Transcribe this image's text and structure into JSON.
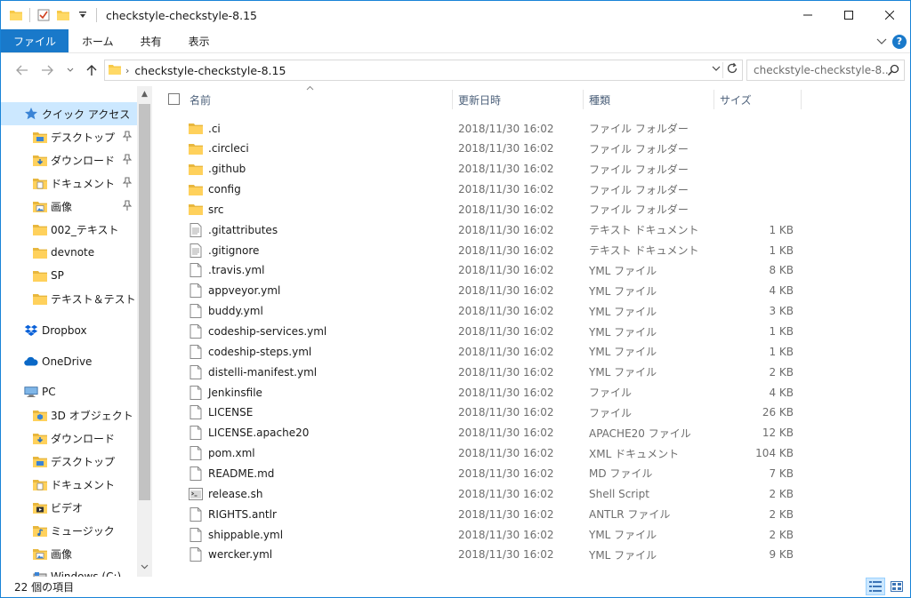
{
  "window": {
    "title": "checkstyle-checkstyle-8.15",
    "accent": "#1979ca"
  },
  "ribbon": {
    "tabs": [
      "ファイル",
      "ホーム",
      "共有",
      "表示"
    ]
  },
  "nav": {
    "address_path": "checkstyle-checkstyle-8.15",
    "search_placeholder": "checkstyle-checkstyle-8..."
  },
  "sidebar": {
    "items": [
      {
        "label": "クイック アクセス",
        "icon": "star-icon",
        "pinned": false,
        "selected": true
      },
      {
        "label": "デスクトップ",
        "icon": "desktop-folder-icon",
        "pinned": true
      },
      {
        "label": "ダウンロード",
        "icon": "download-folder-icon",
        "pinned": true
      },
      {
        "label": "ドキュメント",
        "icon": "documents-folder-icon",
        "pinned": true
      },
      {
        "label": "画像",
        "icon": "pictures-folder-icon",
        "pinned": true
      },
      {
        "label": "002_テキスト",
        "icon": "folder-icon",
        "pinned": false
      },
      {
        "label": "devnote",
        "icon": "folder-icon",
        "pinned": false
      },
      {
        "label": "SP",
        "icon": "folder-icon",
        "pinned": false
      },
      {
        "label": "テキスト＆テスト",
        "icon": "folder-icon",
        "pinned": false
      },
      {
        "label": "Dropbox",
        "icon": "dropbox-icon",
        "pinned": false
      },
      {
        "label": "OneDrive",
        "icon": "onedrive-icon",
        "pinned": false
      },
      {
        "label": "PC",
        "icon": "pc-icon",
        "pinned": false
      },
      {
        "label": "3D オブジェクト",
        "icon": "3d-objects-icon",
        "pinned": false
      },
      {
        "label": "ダウンロード",
        "icon": "download-folder-icon",
        "pinned": false
      },
      {
        "label": "デスクトップ",
        "icon": "desktop-folder-icon",
        "pinned": false
      },
      {
        "label": "ドキュメント",
        "icon": "documents-folder-icon",
        "pinned": false
      },
      {
        "label": "ビデオ",
        "icon": "videos-folder-icon",
        "pinned": false
      },
      {
        "label": "ミュージック",
        "icon": "music-folder-icon",
        "pinned": false
      },
      {
        "label": "画像",
        "icon": "pictures-folder-icon",
        "pinned": false
      },
      {
        "label": "Windows (C:)",
        "icon": "drive-icon",
        "pinned": false
      }
    ]
  },
  "columns": {
    "name": "名前",
    "date": "更新日時",
    "type": "種類",
    "size": "サイズ"
  },
  "files": [
    {
      "name": ".ci",
      "date": "2018/11/30 16:02",
      "type": "ファイル フォルダー",
      "size": "",
      "icon": "folder-icon"
    },
    {
      "name": ".circleci",
      "date": "2018/11/30 16:02",
      "type": "ファイル フォルダー",
      "size": "",
      "icon": "folder-icon"
    },
    {
      "name": ".github",
      "date": "2018/11/30 16:02",
      "type": "ファイル フォルダー",
      "size": "",
      "icon": "folder-icon"
    },
    {
      "name": "config",
      "date": "2018/11/30 16:02",
      "type": "ファイル フォルダー",
      "size": "",
      "icon": "folder-icon"
    },
    {
      "name": "src",
      "date": "2018/11/30 16:02",
      "type": "ファイル フォルダー",
      "size": "",
      "icon": "folder-icon"
    },
    {
      "name": ".gitattributes",
      "date": "2018/11/30 16:02",
      "type": "テキスト ドキュメント",
      "size": "1 KB",
      "icon": "text-file-icon"
    },
    {
      "name": ".gitignore",
      "date": "2018/11/30 16:02",
      "type": "テキスト ドキュメント",
      "size": "1 KB",
      "icon": "text-file-icon"
    },
    {
      "name": ".travis.yml",
      "date": "2018/11/30 16:02",
      "type": "YML ファイル",
      "size": "8 KB",
      "icon": "file-icon"
    },
    {
      "name": "appveyor.yml",
      "date": "2018/11/30 16:02",
      "type": "YML ファイル",
      "size": "4 KB",
      "icon": "file-icon"
    },
    {
      "name": "buddy.yml",
      "date": "2018/11/30 16:02",
      "type": "YML ファイル",
      "size": "3 KB",
      "icon": "file-icon"
    },
    {
      "name": "codeship-services.yml",
      "date": "2018/11/30 16:02",
      "type": "YML ファイル",
      "size": "1 KB",
      "icon": "file-icon"
    },
    {
      "name": "codeship-steps.yml",
      "date": "2018/11/30 16:02",
      "type": "YML ファイル",
      "size": "1 KB",
      "icon": "file-icon"
    },
    {
      "name": "distelli-manifest.yml",
      "date": "2018/11/30 16:02",
      "type": "YML ファイル",
      "size": "2 KB",
      "icon": "file-icon"
    },
    {
      "name": "Jenkinsfile",
      "date": "2018/11/30 16:02",
      "type": "ファイル",
      "size": "4 KB",
      "icon": "file-icon"
    },
    {
      "name": "LICENSE",
      "date": "2018/11/30 16:02",
      "type": "ファイル",
      "size": "26 KB",
      "icon": "file-icon"
    },
    {
      "name": "LICENSE.apache20",
      "date": "2018/11/30 16:02",
      "type": "APACHE20 ファイル",
      "size": "12 KB",
      "icon": "file-icon"
    },
    {
      "name": "pom.xml",
      "date": "2018/11/30 16:02",
      "type": "XML ドキュメント",
      "size": "104 KB",
      "icon": "file-icon"
    },
    {
      "name": "README.md",
      "date": "2018/11/30 16:02",
      "type": "MD ファイル",
      "size": "7 KB",
      "icon": "file-icon"
    },
    {
      "name": "release.sh",
      "date": "2018/11/30 16:02",
      "type": "Shell Script",
      "size": "2 KB",
      "icon": "shell-script-icon"
    },
    {
      "name": "RIGHTS.antlr",
      "date": "2018/11/30 16:02",
      "type": "ANTLR ファイル",
      "size": "2 KB",
      "icon": "file-icon"
    },
    {
      "name": "shippable.yml",
      "date": "2018/11/30 16:02",
      "type": "YML ファイル",
      "size": "2 KB",
      "icon": "file-icon"
    },
    {
      "name": "wercker.yml",
      "date": "2018/11/30 16:02",
      "type": "YML ファイル",
      "size": "9 KB",
      "icon": "file-icon"
    }
  ],
  "status": {
    "item_count": "22 個の項目"
  }
}
